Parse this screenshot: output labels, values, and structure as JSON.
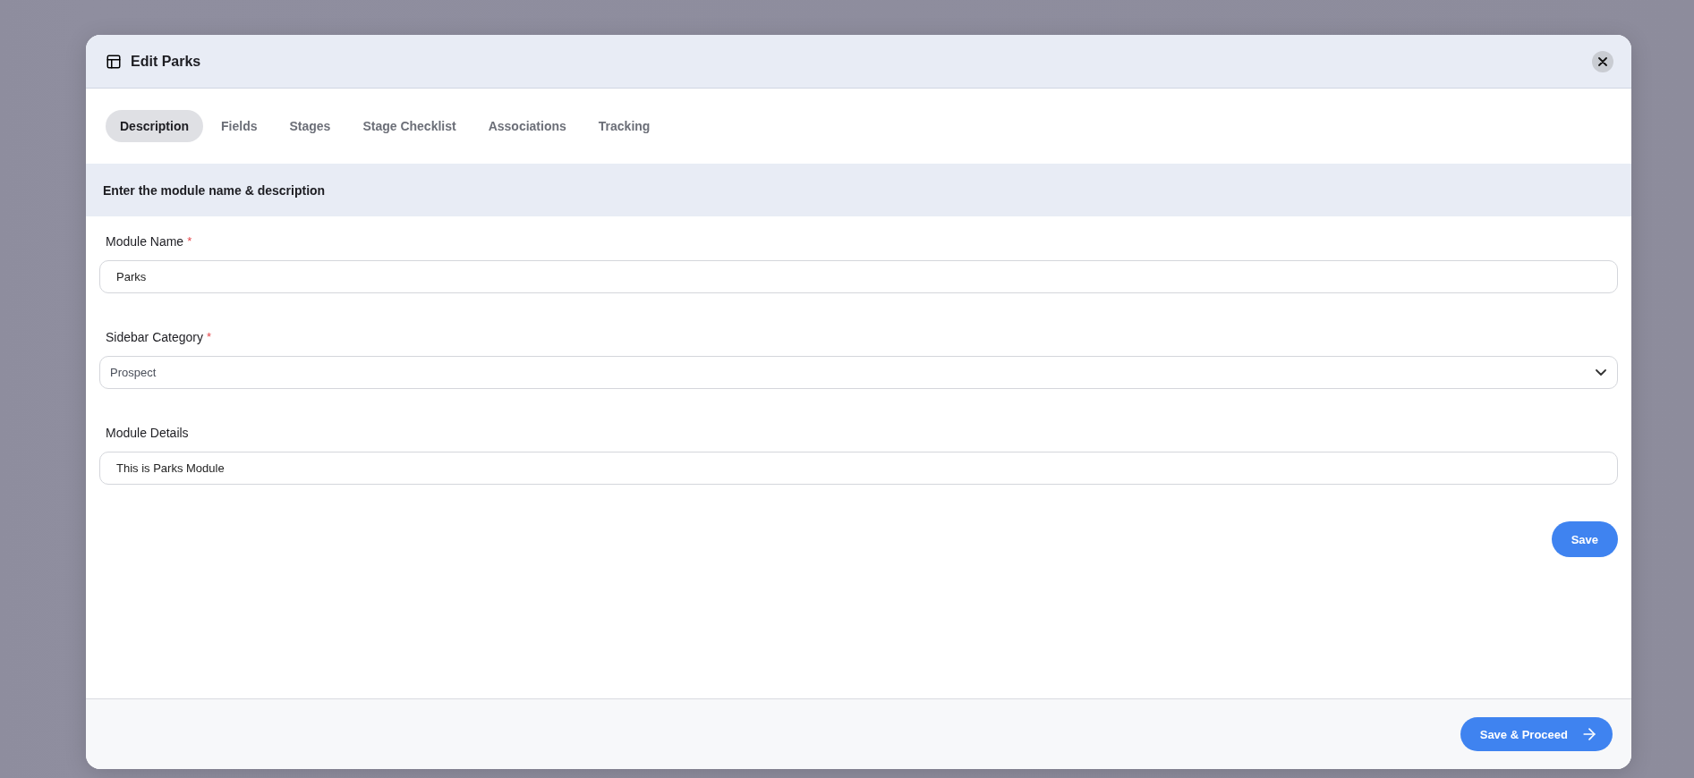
{
  "dialog": {
    "title": "Edit Parks"
  },
  "tabs": [
    {
      "label": "Description",
      "selected": true
    },
    {
      "label": "Fields",
      "selected": false
    },
    {
      "label": "Stages",
      "selected": false
    },
    {
      "label": "Stage Checklist",
      "selected": false
    },
    {
      "label": "Associations",
      "selected": false
    },
    {
      "label": "Tracking",
      "selected": false
    }
  ],
  "section": {
    "title": "Enter the module name & description"
  },
  "fields": [
    {
      "kind": "text",
      "label": "Module Name",
      "required_mark": "*",
      "value": "Parks"
    },
    {
      "kind": "select",
      "label": "Sidebar Category",
      "required_mark": "*",
      "value": "Prospect"
    },
    {
      "kind": "text",
      "label": "Module Details",
      "value": "This is Parks Module"
    }
  ],
  "save_button": "Save",
  "proceed_button": "Save & Proceed"
}
